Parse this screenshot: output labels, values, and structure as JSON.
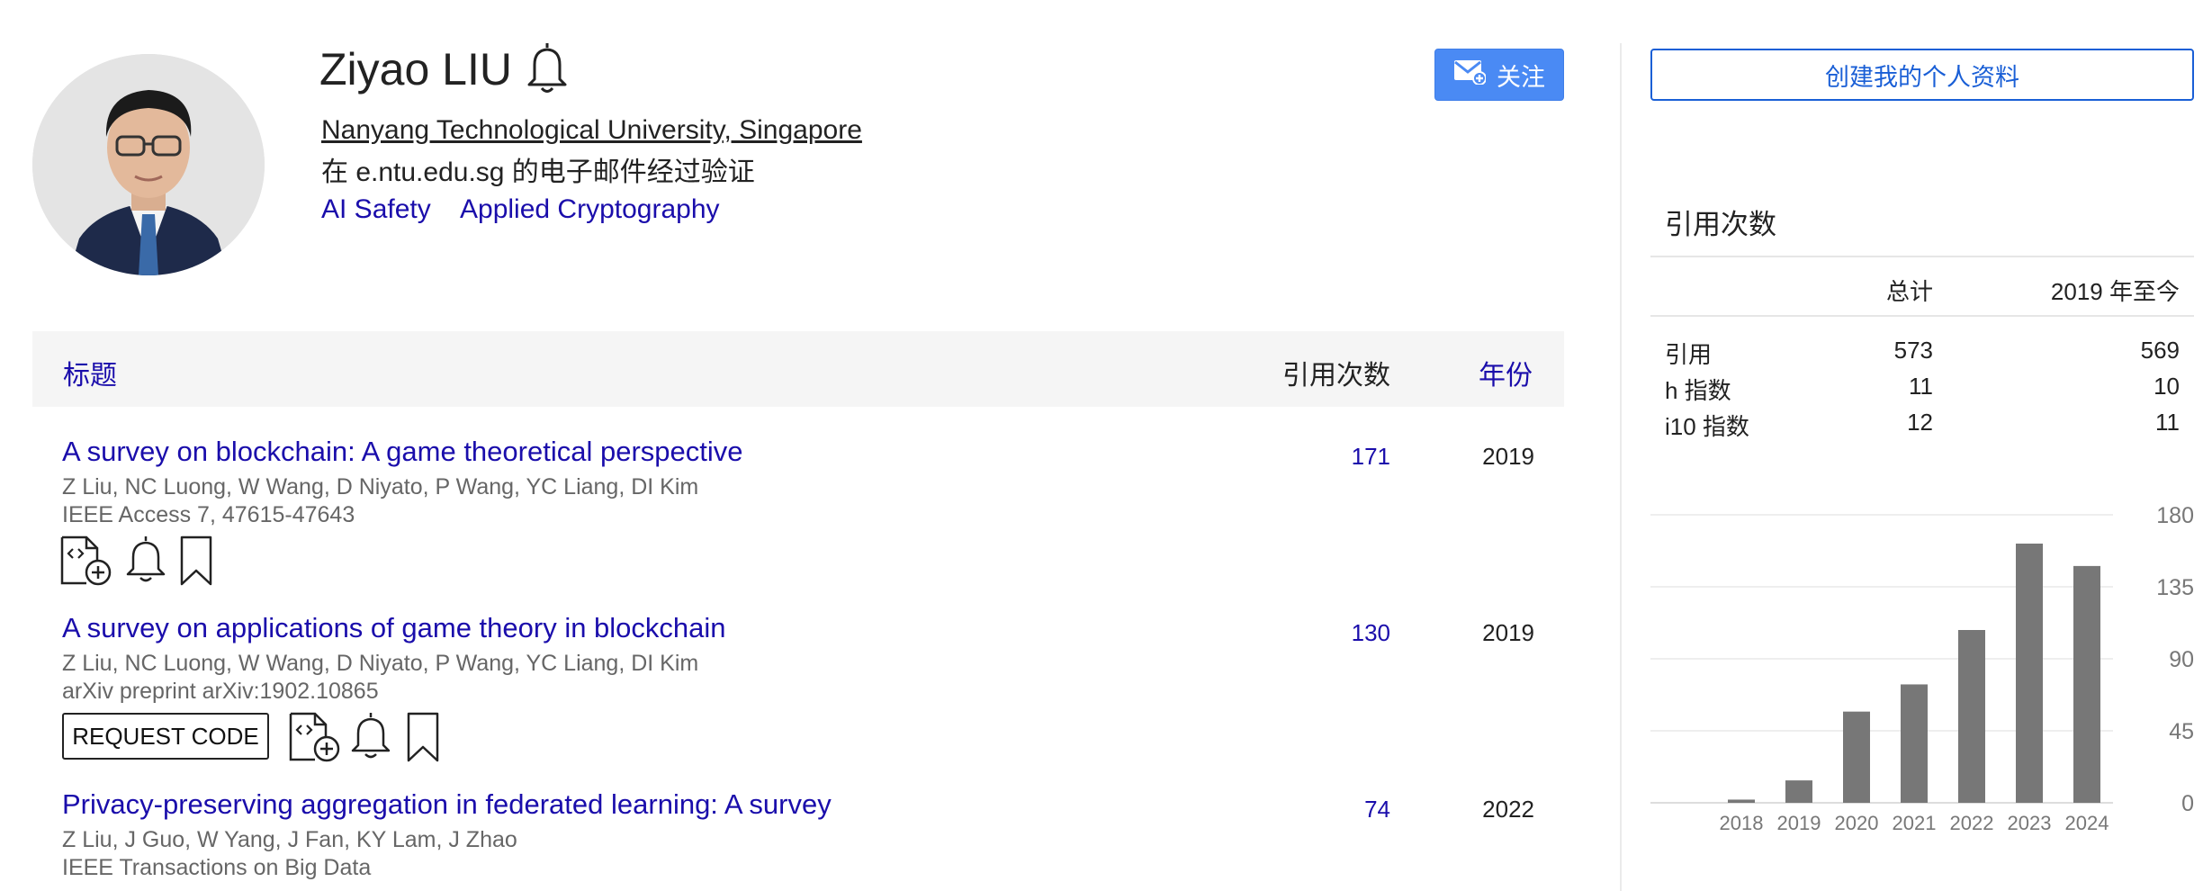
{
  "profile": {
    "name": "Ziyao LIU",
    "affiliation": "Nanyang Technological University, Singapore",
    "verified_email": "在 e.ntu.edu.sg 的电子邮件经过验证",
    "interests": [
      "AI Safety",
      "Applied Cryptography"
    ],
    "follow_label": "关注"
  },
  "table": {
    "col_title": "标题",
    "col_cited": "引用次数",
    "col_year": "年份"
  },
  "articles": [
    {
      "title": "A survey on blockchain: A game theoretical perspective",
      "authors": "Z Liu, NC Luong, W Wang, D Niyato, P Wang, YC Liang, DI Kim",
      "venue": "IEEE Access 7, 47615-47643",
      "cited": "171",
      "year": "2019"
    },
    {
      "title": "A survey on applications of game theory in blockchain",
      "authors": "Z Liu, NC Luong, W Wang, D Niyato, P Wang, YC Liang, DI Kim",
      "venue": "arXiv preprint arXiv:1902.10865",
      "cited": "130",
      "year": "2019",
      "request_code_label": "REQUEST CODE"
    },
    {
      "title": "Privacy-preserving aggregation in federated learning: A survey",
      "authors": "Z Liu, J Guo, W Yang, J Fan, KY Lam, J Zhao",
      "venue": "IEEE Transactions on Big Data",
      "cited": "74",
      "year": "2022"
    }
  ],
  "sidebar": {
    "create_profile_label": "创建我的个人资料",
    "title": "引用次数",
    "col_all": "总计",
    "col_since": "2019 年至今",
    "rows": [
      {
        "label": "引用",
        "all": "573",
        "since": "569"
      },
      {
        "label": "h 指数",
        "all": "11",
        "since": "10"
      },
      {
        "label": "i10 指数",
        "all": "12",
        "since": "11"
      }
    ]
  },
  "chart_data": {
    "type": "bar",
    "categories": [
      "2018",
      "2019",
      "2020",
      "2021",
      "2022",
      "2023",
      "2024"
    ],
    "values": [
      2,
      14,
      57,
      74,
      108,
      162,
      148
    ],
    "y_ticks": [
      "0",
      "45",
      "90",
      "135",
      "180"
    ],
    "ylim": [
      0,
      180
    ],
    "grid": true,
    "bar_color": "#777777"
  },
  "colors": {
    "link": "#1a0dab",
    "follow_button": "#4a8af4",
    "create_button_border": "#1a5fd6"
  }
}
